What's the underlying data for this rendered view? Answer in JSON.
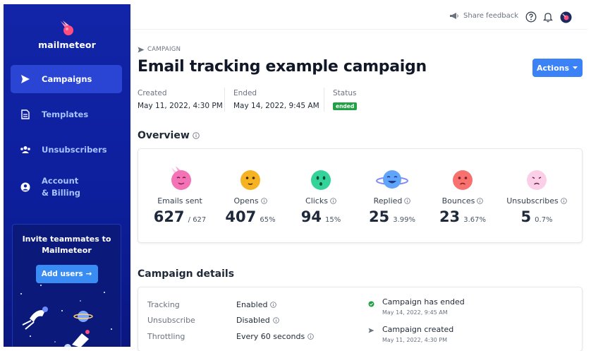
{
  "brand": {
    "name": "mailmeteor"
  },
  "sidebar": {
    "items": [
      {
        "label": "Campaigns",
        "icon": "send-icon",
        "active": true
      },
      {
        "label": "Templates",
        "icon": "document-icon",
        "active": false
      },
      {
        "label": "Unsubscribers",
        "icon": "users-icon",
        "active": false
      },
      {
        "label": "Account\n& Billing",
        "line1": "Account",
        "line2": "& Billing",
        "icon": "user-circle-icon",
        "active": false
      }
    ],
    "invite": {
      "title": "Invite teammates to Mailmeteor",
      "button": "Add users →"
    }
  },
  "topbar": {
    "share_feedback": "Share feedback"
  },
  "breadcrumb": {
    "label": "CAMPAIGN"
  },
  "page": {
    "title": "Email tracking example campaign",
    "actions_label": "Actions"
  },
  "meta": {
    "created_label": "Created",
    "created_value": "May 11, 2022, 4:30 PM",
    "ended_label": "Ended",
    "ended_value": "May 14, 2022, 9:45 AM",
    "status_label": "Status",
    "status_value": "ended"
  },
  "overview": {
    "title": "Overview",
    "stats": [
      {
        "label": "Emails sent",
        "value": "627",
        "sub": "/ 627",
        "info": false,
        "color": "#f472b6"
      },
      {
        "label": "Opens",
        "value": "407",
        "sub": "65%",
        "info": true,
        "color": "#f5b324"
      },
      {
        "label": "Clicks",
        "value": "94",
        "sub": "15%",
        "info": true,
        "color": "#34d399"
      },
      {
        "label": "Replied",
        "value": "25",
        "sub": "3.99%",
        "info": true,
        "color": "#60a5fa"
      },
      {
        "label": "Bounces",
        "value": "23",
        "sub": "3.67%",
        "info": true,
        "color": "#f87171"
      },
      {
        "label": "Unsubscribes",
        "value": "5",
        "sub": "0.7%",
        "info": true,
        "color": "#fbcfe8"
      }
    ]
  },
  "details": {
    "title": "Campaign details",
    "rows": [
      {
        "label": "Tracking",
        "value": "Enabled"
      },
      {
        "label": "Unsubscribe",
        "value": "Disabled"
      },
      {
        "label": "Throttling",
        "value": "Every 60 seconds"
      }
    ],
    "timeline": [
      {
        "title": "Campaign has ended",
        "date": "May 14, 2022, 9:45 AM"
      },
      {
        "title": "Campaign created",
        "date": "May 11, 2022, 4:30 PM"
      }
    ]
  },
  "colors": {
    "sidebar": "#1225a8",
    "active_nav": "#2a45d4",
    "accent": "#3b82f6",
    "status_green": "#22a046"
  }
}
